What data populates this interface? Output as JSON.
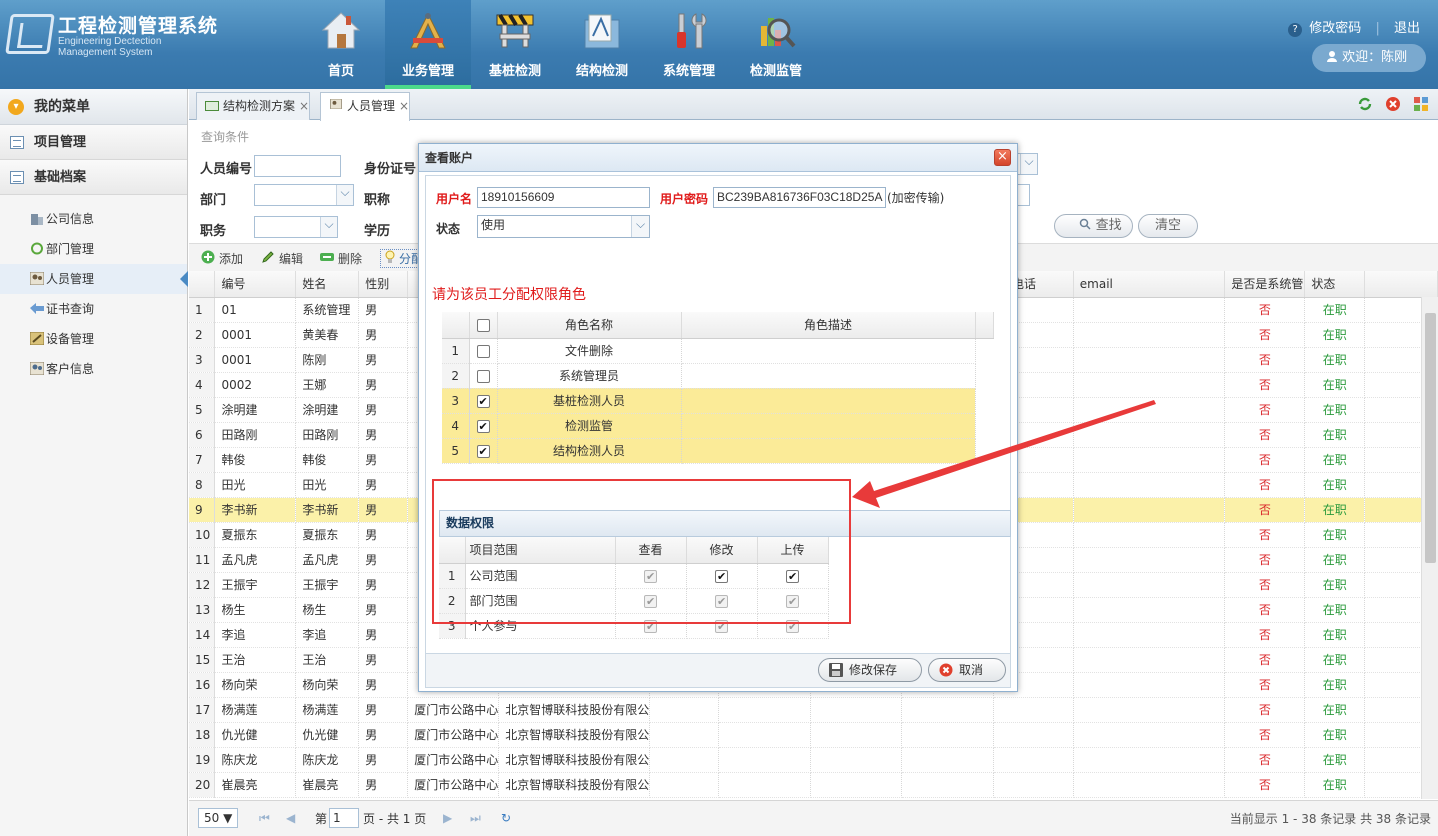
{
  "header": {
    "title": "工程检测管理系统",
    "subtitle_line1": "Engineering Dectection",
    "subtitle_line2": "Management System",
    "nav": [
      {
        "label": "首页",
        "icon": "house-icon"
      },
      {
        "label": "业务管理",
        "icon": "design-tools-icon",
        "active": true
      },
      {
        "label": "基桩检测",
        "icon": "barrier-icon"
      },
      {
        "label": "结构检测",
        "icon": "folder-drawing-icon"
      },
      {
        "label": "系统管理",
        "icon": "tools-icon"
      },
      {
        "label": "检测监管",
        "icon": "magnifier-icon"
      }
    ],
    "help_glyph": "?",
    "change_password": "修改密码",
    "logout": "退出",
    "welcome": "欢迎：陈刚"
  },
  "sidebar": {
    "title": "我的菜单",
    "groups": [
      {
        "label": "项目管理"
      },
      {
        "label": "基础档案"
      }
    ],
    "items": [
      {
        "label": "公司信息",
        "icon": "building-icon"
      },
      {
        "label": "部门管理",
        "icon": "circle-icon"
      },
      {
        "label": "人员管理",
        "icon": "people-icon",
        "active": true
      },
      {
        "label": "证书查询",
        "icon": "certificate-icon"
      },
      {
        "label": "设备管理",
        "icon": "equipment-icon"
      },
      {
        "label": "客户信息",
        "icon": "customers-icon"
      }
    ]
  },
  "tabs": [
    {
      "label": "结构检测方案",
      "close": "×"
    },
    {
      "label": "人员管理",
      "close": "×",
      "active": true
    }
  ],
  "query": {
    "title": "查询条件",
    "emp_no_label": "人员编号",
    "id_card_label": "身份证号",
    "dept_label": "部门",
    "title_label": "职称",
    "position_label": "职务",
    "education_label": "学历",
    "search_label": "查找",
    "clear_label": "清空"
  },
  "toolbar": {
    "add": "添加",
    "edit": "编辑",
    "delete": "删除",
    "assign": "分配"
  },
  "grid": {
    "columns": [
      "编号",
      "姓名",
      "性别",
      "",
      "",
      "系电话",
      "email",
      "是否是系统管",
      "状态"
    ],
    "rows": [
      {
        "n": "1",
        "no": "01",
        "name": "系统管理",
        "sex": "男",
        "org": "",
        "company": "",
        "sys": "否",
        "status": "在职"
      },
      {
        "n": "2",
        "no": "0001",
        "name": "黄美春",
        "sex": "男",
        "org": "",
        "company": "",
        "sys": "否",
        "status": "在职"
      },
      {
        "n": "3",
        "no": "0001",
        "name": "陈刚",
        "sex": "男",
        "org": "",
        "company": "",
        "sys": "否",
        "status": "在职"
      },
      {
        "n": "4",
        "no": "0002",
        "name": "王娜",
        "sex": "男",
        "org": "",
        "company": "",
        "sys": "否",
        "status": "在职"
      },
      {
        "n": "5",
        "no": "涂明建",
        "name": "涂明建",
        "sex": "男",
        "org": "",
        "company": "",
        "sys": "否",
        "status": "在职"
      },
      {
        "n": "6",
        "no": "田路刚",
        "name": "田路刚",
        "sex": "男",
        "org": "",
        "company": "",
        "sys": "否",
        "status": "在职"
      },
      {
        "n": "7",
        "no": "韩俊",
        "name": "韩俊",
        "sex": "男",
        "org": "",
        "company": "",
        "sys": "否",
        "status": "在职"
      },
      {
        "n": "8",
        "no": "田光",
        "name": "田光",
        "sex": "男",
        "org": "",
        "company": "",
        "sys": "否",
        "status": "在职"
      },
      {
        "n": "9",
        "no": "李书新",
        "name": "李书新",
        "sex": "男",
        "org": "",
        "company": "",
        "sys": "否",
        "status": "在职",
        "selected": true
      },
      {
        "n": "10",
        "no": "夏振东",
        "name": "夏振东",
        "sex": "男",
        "org": "",
        "company": "",
        "sys": "否",
        "status": "在职"
      },
      {
        "n": "11",
        "no": "孟凡虎",
        "name": "孟凡虎",
        "sex": "男",
        "org": "",
        "company": "",
        "sys": "否",
        "status": "在职"
      },
      {
        "n": "12",
        "no": "王振宇",
        "name": "王振宇",
        "sex": "男",
        "org": "",
        "company": "",
        "sys": "否",
        "status": "在职"
      },
      {
        "n": "13",
        "no": "杨生",
        "name": "杨生",
        "sex": "男",
        "org": "",
        "company": "",
        "sys": "否",
        "status": "在职"
      },
      {
        "n": "14",
        "no": "李追",
        "name": "李追",
        "sex": "男",
        "org": "",
        "company": "",
        "sys": "否",
        "status": "在职"
      },
      {
        "n": "15",
        "no": "王治",
        "name": "王治",
        "sex": "男",
        "org": "",
        "company": "",
        "sys": "否",
        "status": "在职"
      },
      {
        "n": "16",
        "no": "杨向荣",
        "name": "杨向荣",
        "sex": "男",
        "org": "",
        "company": "",
        "sys": "否",
        "status": "在职"
      },
      {
        "n": "17",
        "no": "杨满莲",
        "name": "杨满莲",
        "sex": "男",
        "org": "厦门市公路中心",
        "company": "北京智博联科技股份有限公",
        "sys": "否",
        "status": "在职"
      },
      {
        "n": "18",
        "no": "仇光健",
        "name": "仇光健",
        "sex": "男",
        "org": "厦门市公路中心",
        "company": "北京智博联科技股份有限公",
        "sys": "否",
        "status": "在职"
      },
      {
        "n": "19",
        "no": "陈庆龙",
        "name": "陈庆龙",
        "sex": "男",
        "org": "厦门市公路中心",
        "company": "北京智博联科技股份有限公",
        "sys": "否",
        "status": "在职"
      },
      {
        "n": "20",
        "no": "崔晨亮",
        "name": "崔晨亮",
        "sex": "男",
        "org": "厦门市公路中心",
        "company": "北京智博联科技股份有限公",
        "sys": "否",
        "status": "在职"
      }
    ]
  },
  "pager": {
    "page_size": "50 ▼",
    "page_prefix": "第",
    "page": "1",
    "page_suffix": "页 - 共 1 页",
    "summary": "当前显示 1 - 38 条记录 共 38 条记录"
  },
  "modal": {
    "title": "查看账户",
    "close": "×",
    "username_label": "用户名",
    "username": "18910156609",
    "password_label": "用户密码",
    "password": "BC239BA816736F03C18D25A",
    "encrypt_note": "(加密传输)",
    "status_label": "状态",
    "status": "使用",
    "assign_title": "请为该员工分配权限角色",
    "role_columns": [
      "角色名称",
      "角色描述"
    ],
    "roles": [
      {
        "n": "1",
        "name": "文件删除",
        "checked": false
      },
      {
        "n": "2",
        "name": "系统管理员",
        "checked": false
      },
      {
        "n": "3",
        "name": "基桩检测人员",
        "checked": true
      },
      {
        "n": "4",
        "name": "检测监管",
        "checked": true
      },
      {
        "n": "5",
        "name": "结构检测人员",
        "checked": true
      }
    ],
    "perm_title": "数据权限",
    "perm_columns": [
      "项目范围",
      "查看",
      "修改",
      "上传"
    ],
    "perms": [
      {
        "n": "1",
        "scope": "公司范围",
        "view": true,
        "edit": true,
        "upload": true
      },
      {
        "n": "2",
        "scope": "部门范围",
        "view": true,
        "edit": true,
        "upload": true
      },
      {
        "n": "3",
        "scope": "个人参与",
        "view": true,
        "edit": true,
        "upload": true
      }
    ],
    "save_label": "修改保存",
    "cancel_label": "取消"
  },
  "colors": {
    "accent": "#3b7bb0",
    "annotation": "#e83a3a",
    "selected_row": "#fbf1a9",
    "checked_role": "#fbeb98"
  }
}
